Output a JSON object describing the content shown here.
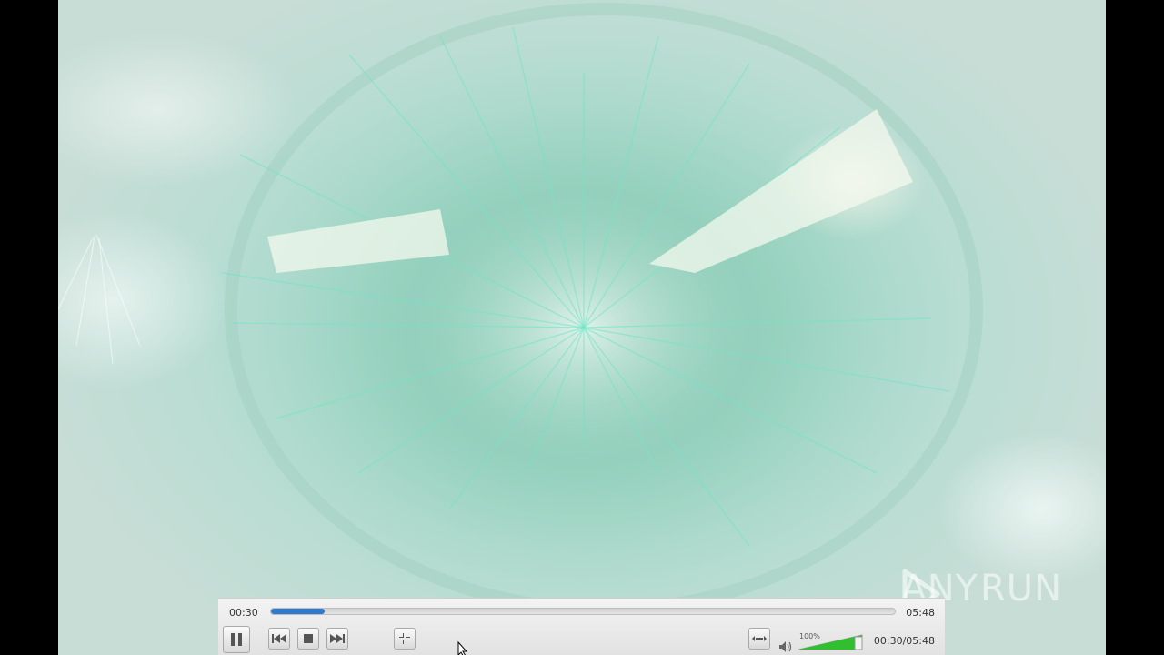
{
  "player": {
    "elapsed": "00:30",
    "total": "05:48",
    "status_time": "00:30/05:48",
    "progress_fraction": 0.086,
    "volume_label": "100%",
    "volume_fraction": 1.0
  },
  "watermark": {
    "text_left": "ANY",
    "text_right": "RUN"
  },
  "colors": {
    "seek_fill": "#2f79cf",
    "volume_fill": "#2fbf2f",
    "controller_bg": "#e8e8e8"
  },
  "icons": {
    "pause": "pause-icon",
    "previous": "skip-previous-icon",
    "stop": "stop-icon",
    "next": "skip-next-icon",
    "fullscreen": "fullscreen-icon",
    "extended": "extended-settings-icon",
    "volume": "speaker-icon"
  }
}
